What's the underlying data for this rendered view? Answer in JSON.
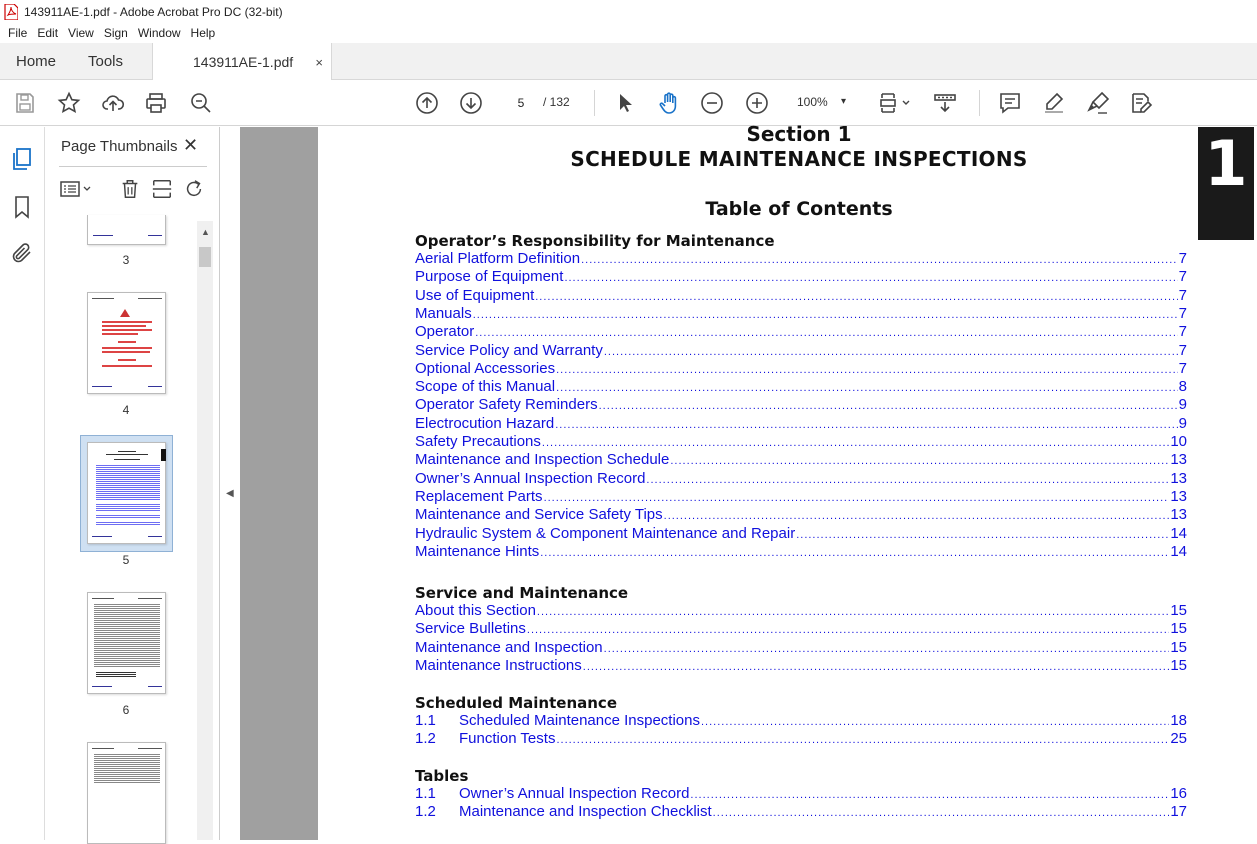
{
  "window": {
    "title": "143911AE-1.pdf - Adobe Acrobat Pro DC (32-bit)",
    "menu": [
      "File",
      "Edit",
      "View",
      "Sign",
      "Window",
      "Help"
    ]
  },
  "tabs": {
    "home": "Home",
    "tools": "Tools",
    "document": "143911AE-1.pdf",
    "close": "×"
  },
  "toolbar": {
    "current_page": "5",
    "total_pages": "/ 132",
    "zoom": "100%",
    "zoom_arrow": "▾"
  },
  "panel": {
    "title": "Page Thumbnails",
    "close": "✕",
    "thumbnails": [
      {
        "label": "3"
      },
      {
        "label": "4"
      },
      {
        "label": "5",
        "selected": true
      },
      {
        "label": "6"
      },
      {
        "label": ""
      }
    ]
  },
  "document": {
    "section_tab": "1",
    "section": "Section 1",
    "title": "SCHEDULE MAINTENANCE INSPECTIONS",
    "toc_title": "Table of Contents",
    "groups": [
      {
        "heading": "Operator’s Responsibility for Maintenance",
        "rows": [
          {
            "num": "",
            "label": "Aerial Platform Definition",
            "page": "7"
          },
          {
            "num": "",
            "label": "Purpose of Equipment",
            "page": "7"
          },
          {
            "num": "",
            "label": "Use of Equipment",
            "page": "7"
          },
          {
            "num": "",
            "label": "Manuals",
            "page": "7"
          },
          {
            "num": "",
            "label": "Operator",
            "page": "7"
          },
          {
            "num": "",
            "label": "Service Policy and Warranty",
            "page": "7"
          },
          {
            "num": "",
            "label": "Optional Accessories",
            "page": "7"
          },
          {
            "num": "",
            "label": "Scope of this Manual",
            "page": "8"
          },
          {
            "num": "",
            "label": "Operator Safety Reminders",
            "page": "9"
          },
          {
            "num": "",
            "label": "Electrocution Hazard",
            "page": "9"
          },
          {
            "num": "",
            "label": "Safety Precautions",
            "page": "10"
          },
          {
            "num": "",
            "label": "Maintenance and Inspection Schedule",
            "page": "13"
          },
          {
            "num": "",
            "label": "Owner’s Annual Inspection Record",
            "page": "13"
          },
          {
            "num": "",
            "label": "Replacement Parts",
            "page": "13"
          },
          {
            "num": "",
            "label": "Maintenance and Service Safety Tips",
            "page": "13"
          },
          {
            "num": "",
            "label": "Hydraulic System & Component Maintenance and Repair",
            "page": "14"
          },
          {
            "num": "",
            "label": "Maintenance Hints",
            "page": "14"
          }
        ]
      },
      {
        "heading": "Service and Maintenance",
        "rows": [
          {
            "num": "",
            "label": "About this Section",
            "page": "15"
          },
          {
            "num": "",
            "label": "Service Bulletins",
            "page": "15"
          },
          {
            "num": "",
            "label": "Maintenance and Inspection",
            "page": "15"
          },
          {
            "num": "",
            "label": "Maintenance Instructions",
            "page": "15"
          }
        ]
      },
      {
        "heading": "Scheduled Maintenance",
        "rows": [
          {
            "num": "1.1",
            "label": "Scheduled Maintenance Inspections",
            "page": "18"
          },
          {
            "num": "1.2",
            "label": "Function Tests",
            "page": "25"
          }
        ]
      },
      {
        "heading": "Tables",
        "rows": [
          {
            "num": "1.1",
            "label": "Owner’s Annual Inspection Record",
            "page": "16"
          },
          {
            "num": "1.2",
            "label": "Maintenance and Inspection Checklist",
            "page": "17"
          }
        ]
      }
    ]
  },
  "colors": {
    "link": "#1010dd",
    "section_tab_bg": "#1a1a1a",
    "canvas": "#a0a0a0",
    "selected_thumb": "#cfe0f2"
  }
}
